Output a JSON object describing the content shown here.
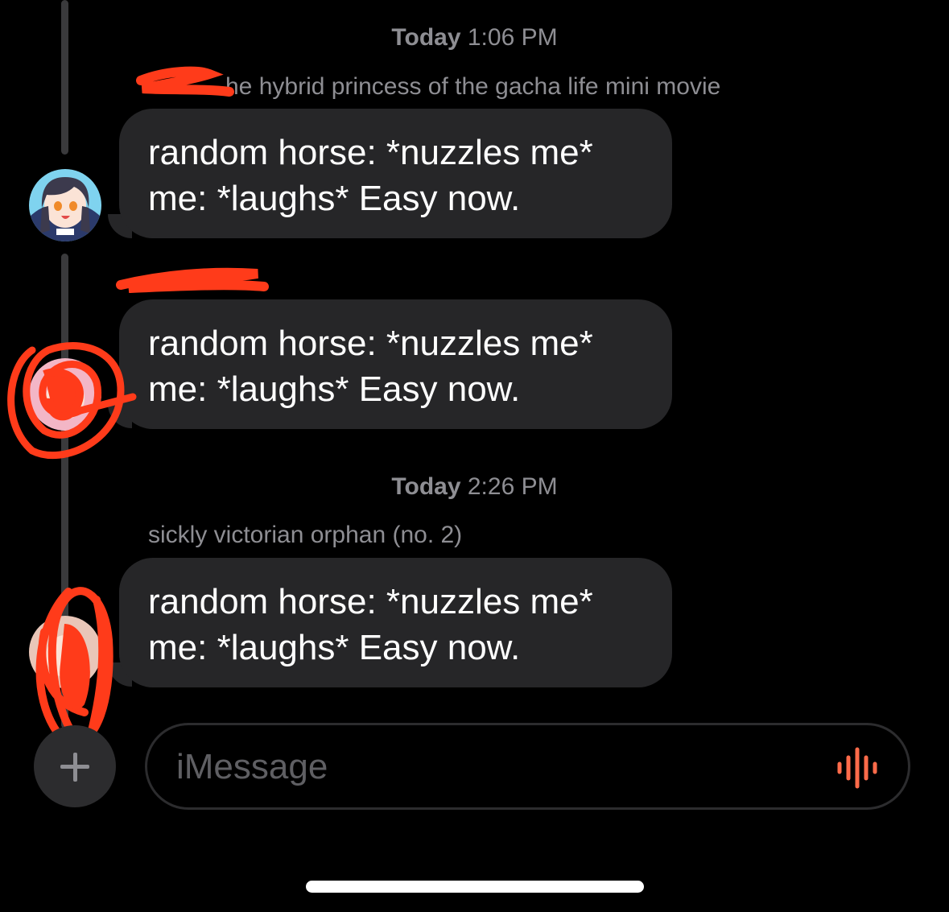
{
  "timestamps": [
    {
      "day": "Today",
      "time": "1:06 PM"
    },
    {
      "day": "Today",
      "time": "2:26 PM"
    }
  ],
  "senders": [
    "he hybrid princess of the gacha life mini movie",
    "",
    "sickly victorian orphan (no. 2)"
  ],
  "messages": [
    {
      "line1": "random horse: *nuzzles me*",
      "line2": "me: *laughs* Easy now."
    },
    {
      "line1": "random horse: *nuzzles me*",
      "line2": "me: *laughs* Easy now."
    },
    {
      "line1": "random horse: *nuzzles me*",
      "line2": "me: *laughs* Easy now."
    }
  ],
  "input": {
    "placeholder": "iMessage",
    "value": ""
  },
  "icons": {
    "add": "plus-icon",
    "voice": "waveform-icon"
  },
  "colors": {
    "background": "#000000",
    "bubble": "#262628",
    "secondary_text": "#8e8e93",
    "voice_icon": "#ff6b4a",
    "redaction": "#ff3b1a"
  }
}
